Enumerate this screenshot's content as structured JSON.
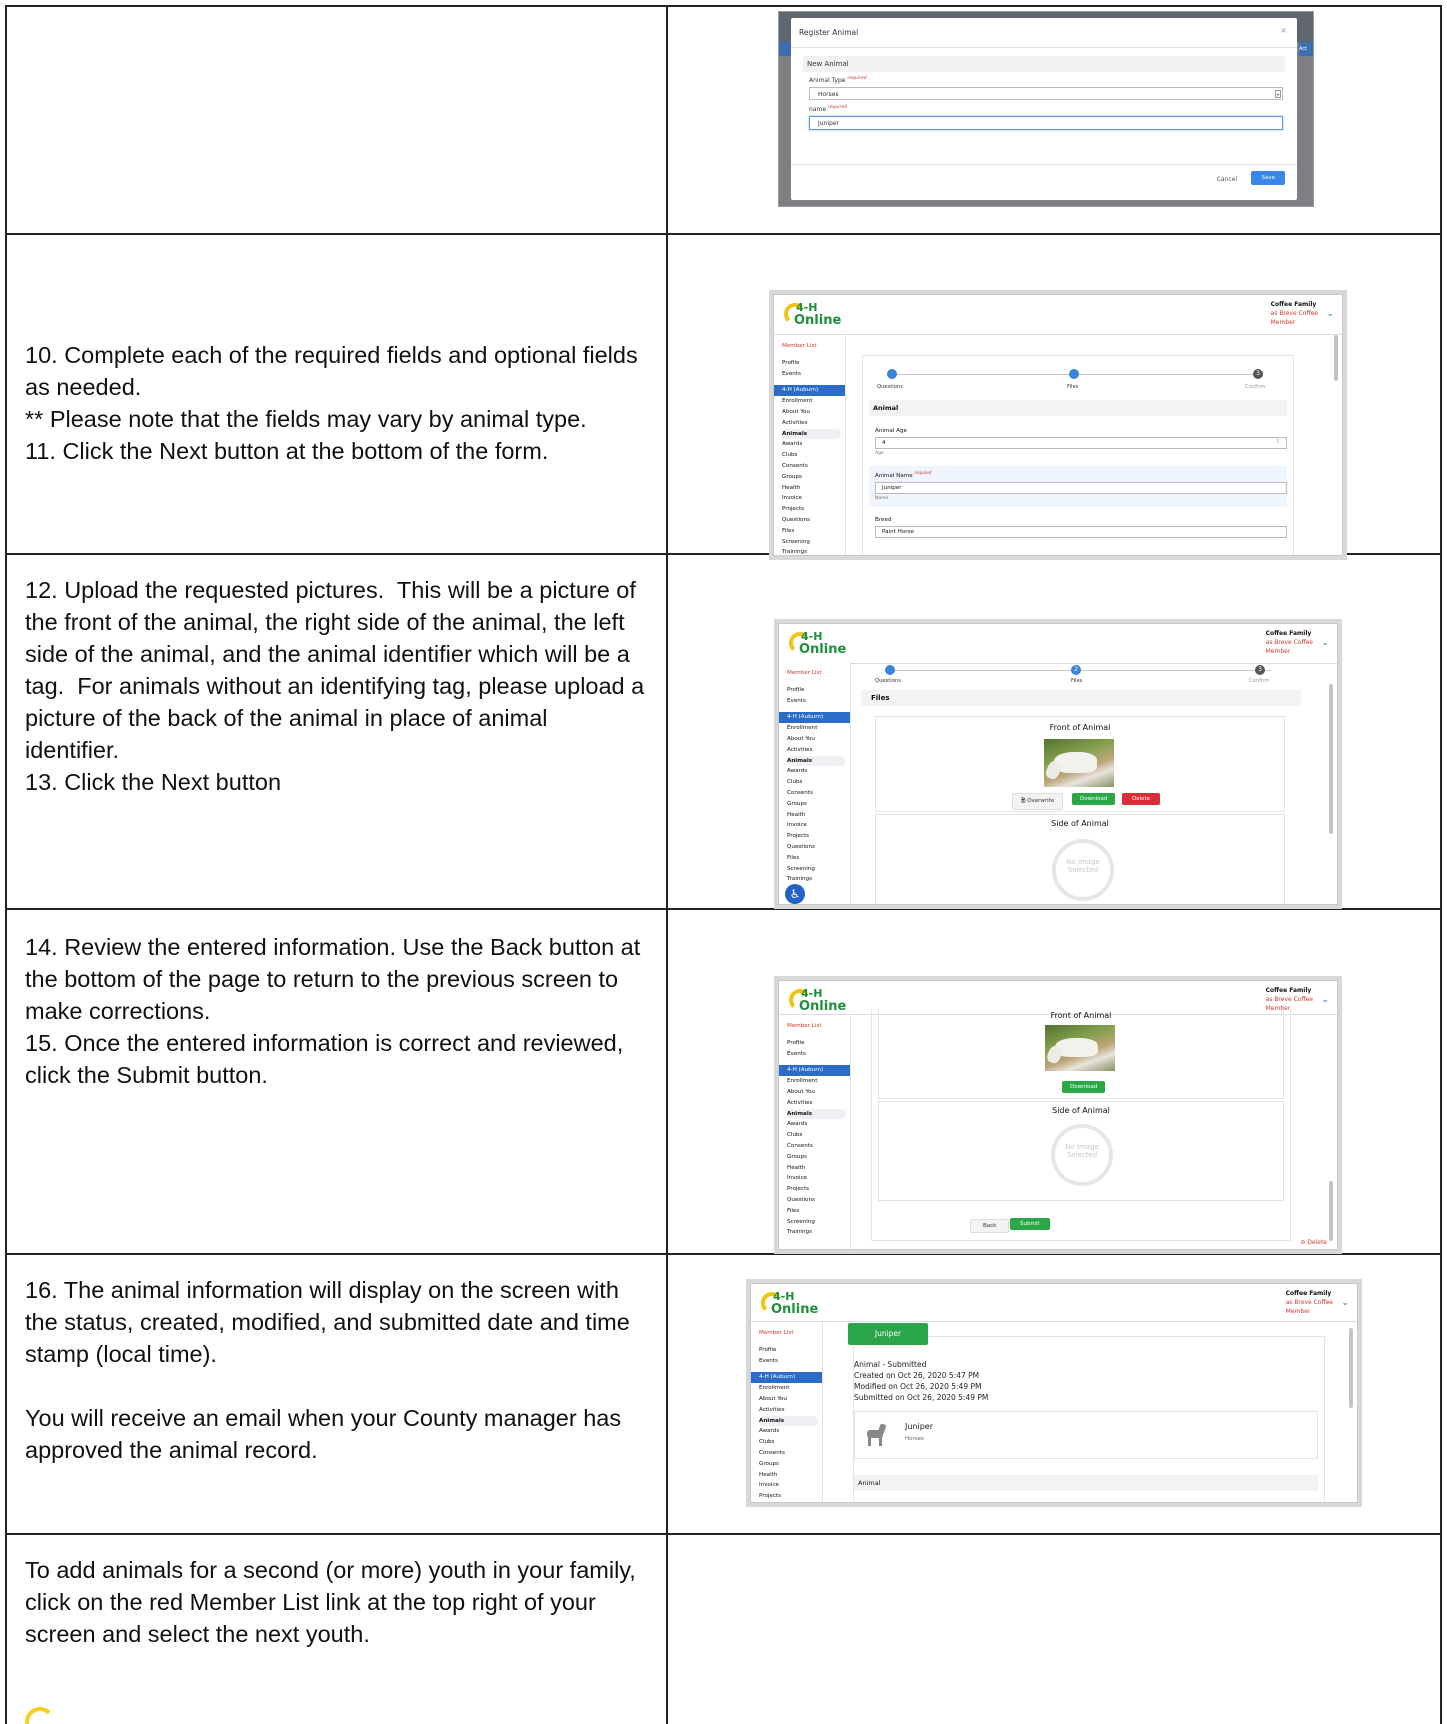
{
  "rows": [
    {
      "id": "r1",
      "text": ""
    },
    {
      "id": "r2",
      "paragraphs": [
        "10. Complete each of the required fields and optional fields as needed.",
        "** Please note that the fields may vary by animal type.",
        "11. Click the Next button at the bottom of the form."
      ]
    },
    {
      "id": "r3",
      "paragraphs": [
        "12. Upload the requested pictures.  This will be a picture of the front of the animal, the right side of the animal, the left side of the animal, and the animal identifier which will be a tag.  For animals without an identifying tag, please upload a picture of the back of the animal in place of animal identifier.",
        "13. Click the Next button"
      ]
    },
    {
      "id": "r4",
      "paragraphs": [
        "14. Review the entered information. Use the Back button at the bottom of the page to return to the previous screen to make corrections.",
        "15. Once the entered information is correct and reviewed, click the Submit button."
      ]
    },
    {
      "id": "r5",
      "paragraphs": [
        "16. The animal information will display on the screen with the status, created, modified, and submitted date and time stamp (local time).",
        "",
        "You will receive an email when your County manager has approved the animal record."
      ]
    },
    {
      "id": "r6",
      "paragraphs": [
        "To add animals for a second (or more) youth in your family, click on the red Member List link at the top right of your screen and select the next youth."
      ]
    }
  ],
  "app": {
    "logo_top": "4-H",
    "logo_bottom": "Online",
    "account_name": "Coffee Family",
    "account_as": "as Breve Coffee",
    "account_role": "Member",
    "member_list": "Member List",
    "sidebar_top": [
      "Profile",
      "Events"
    ],
    "group_label": "4-H (Auburn)",
    "sidebar_items": [
      "Enrollment",
      "About You",
      "Activities",
      "Animals",
      "Awards",
      "Clubs",
      "Consents",
      "Groups",
      "Health",
      "Invoice",
      "Projects",
      "Questions",
      "Files",
      "Screening",
      "Trainings"
    ],
    "steps": [
      "Questions",
      "Files",
      "Confirm"
    ]
  },
  "register_modal": {
    "title": "Register Animal",
    "close": "×",
    "section": "New Animal",
    "type_label": "Animal Type",
    "required": "required",
    "type_value": "Horses",
    "name_label": "name",
    "name_value": "Juniper",
    "cancel": "Cancel",
    "save": "Save",
    "edge_text": "Act"
  },
  "questions_form": {
    "section": "Animal",
    "age_label": "Animal Age",
    "age_value": "4",
    "age_hint": "Age",
    "name_label": "Animal Name",
    "required": "required",
    "name_value": "Juniper",
    "name_hint": "Name",
    "breed_label": "Breed",
    "breed_value": "Paint Horse"
  },
  "files_form": {
    "section": "Files",
    "front_label": "Front of Animal",
    "side_label": "Side of Animal",
    "overwrite": "Overwrite",
    "download": "Download",
    "delete": "Delete",
    "no_image": "No Image Selected"
  },
  "confirm_form": {
    "front_label": "Front of Animal",
    "side_label": "Side of Animal",
    "download": "Download",
    "no_image": "No Image Selected",
    "back": "Back",
    "submit": "Submit",
    "delete": "Delete"
  },
  "submitted": {
    "tab": "Juniper",
    "status": "Animal - Submitted",
    "created": "Created on Oct 26, 2020 5:47 PM",
    "modified": "Modified on Oct 26, 2020 5:49 PM",
    "submitted_on": "Submitted on Oct 26, 2020 5:49 PM",
    "card_name": "Juniper",
    "card_type": "Horses",
    "section": "Animal"
  },
  "colors": {
    "brand_green": "#1e8f3a",
    "accent_blue": "#2b6cc8",
    "link_red": "#d0392b",
    "logo_yellow": "#f1c40f"
  }
}
